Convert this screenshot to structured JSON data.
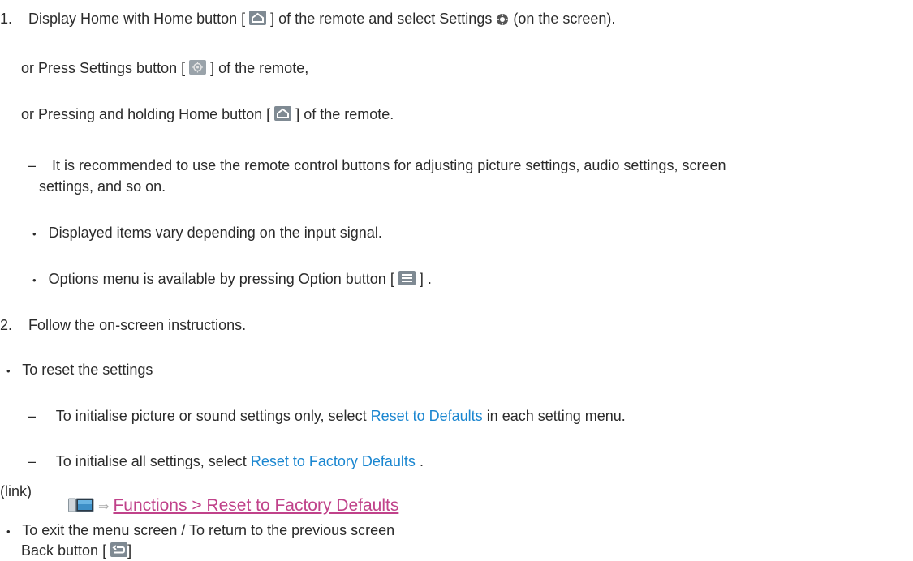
{
  "step1": {
    "number": "1.",
    "part1": "Display Home with Home button [",
    "part2": "] of the remote and select Settings",
    "part3": "(on the screen)."
  },
  "alt1": {
    "part1": "or Press Settings button [",
    "part2": "] of the remote,"
  },
  "alt2": {
    "part1": "or Pressing and holding Home button [",
    "part2": "] of the remote."
  },
  "note1": {
    "dash": "–",
    "line1": "It is recommended to use the remote control buttons for adjusting picture settings, audio settings, screen",
    "line2": "settings, and so on."
  },
  "bullet1": {
    "bullet": "•",
    "text": "Displayed items vary depending on the input signal."
  },
  "bullet2": {
    "bullet": "•",
    "part1": "Options menu is available by pressing Option button [",
    "part2": "] ."
  },
  "step2": {
    "number": "2.",
    "text": "Follow the on-screen instructions."
  },
  "reset": {
    "bullet": "•",
    "heading": "To reset the settings",
    "item1": {
      "dash": "–",
      "part1": "To initialise picture or sound settings only, select",
      "link": "Reset to Defaults",
      "part2": "in each setting menu."
    },
    "item2": {
      "dash": "–",
      "part1": "To initialise all settings, select",
      "link": "Reset to Factory Defaults",
      "part2": "."
    }
  },
  "link_label": "(link)",
  "reference": {
    "arrow": "⇒",
    "text": "Functions > Reset to Factory Defaults"
  },
  "exit": {
    "bullet": "•",
    "heading": "To exit the menu screen / To return to the previous screen",
    "part1": "Back button [",
    "part2": "]"
  },
  "icons": {
    "home": "home-icon",
    "settings_gear": "gear-icon",
    "settings_button": "settings-button-icon",
    "option": "option-menu-icon",
    "reference": "tv-reference-icon",
    "back": "back-icon"
  },
  "colors": {
    "link": "#1a86d0",
    "reference_link": "#c0428a",
    "icon_gray": "#7f8a93"
  }
}
